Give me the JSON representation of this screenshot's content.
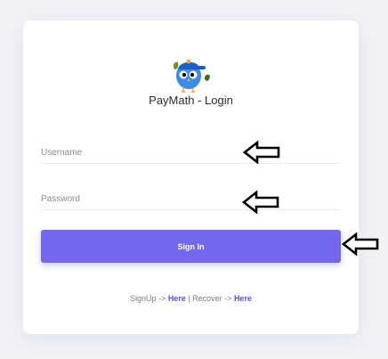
{
  "app": {
    "title": "PayMath - Login"
  },
  "form": {
    "username_placeholder": "Username",
    "username_value": "",
    "password_placeholder": "Password",
    "password_value": "",
    "signin_label": "Sign In"
  },
  "footer": {
    "signup_text": "SignUp -> ",
    "signup_link": "Here",
    "separator": " | Recover -> ",
    "recover_link": "Here"
  },
  "icons": {
    "logo": "bird-mascot-icon",
    "annotation": "left-arrow-icon"
  },
  "colors": {
    "accent": "#7367f0",
    "link": "#5a4ef0",
    "background": "#f1f1f6"
  }
}
